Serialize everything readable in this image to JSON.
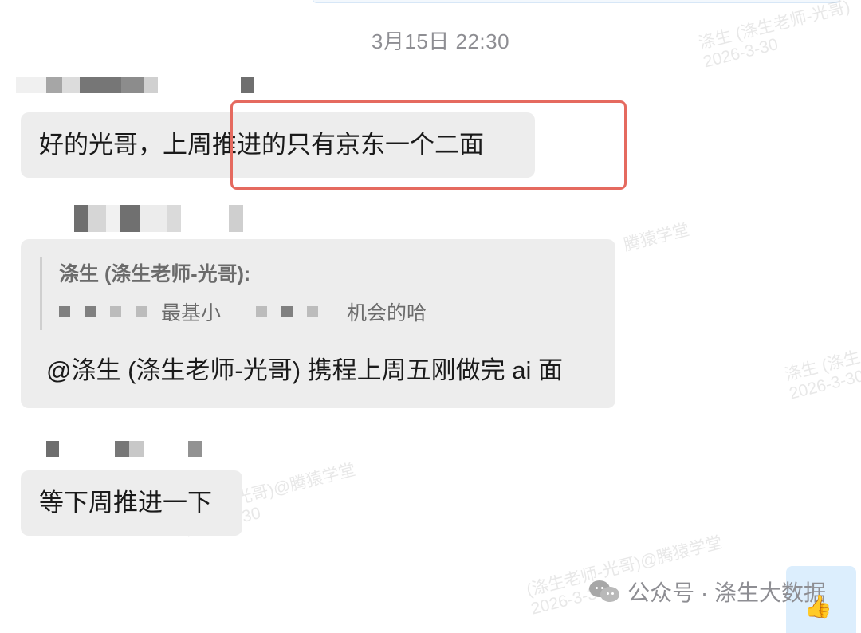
{
  "chat": {
    "timestamp": "3月15日 22:30",
    "messages": [
      {
        "text": "好的光哥，上周推进的只有京东一个二面"
      },
      {
        "quote_author": "涤生 (涤生老师-光哥):",
        "quote_visible_text_1": "最基小",
        "quote_visible_text_2": "机会的哈",
        "text": "@涤生 (涤生老师-光哥)  携程上周五刚做完 ai 面"
      },
      {
        "text": "等下周推进一下"
      }
    ]
  },
  "watermark": {
    "text_1": "涤生 (涤生老师-光哥)",
    "date": "2026-3-30",
    "text_2": "腾猿学堂",
    "text_3": "涤生 (涤生",
    "text_4": "生老师-光哥)@腾猿学堂",
    "text_5": "2026-3-30",
    "text_6": "(涤生老师-光哥)@腾猿学堂",
    "text_7": "2026-3-30"
  },
  "public_account": {
    "label": "公众号 · 涤生大数据",
    "icon": "wechat-icon",
    "thumb_icon": "thumbs-up-icon"
  },
  "colors": {
    "bubble": "#ededed",
    "highlight": "#e56a5f",
    "secondary_text": "#8e8e93"
  }
}
